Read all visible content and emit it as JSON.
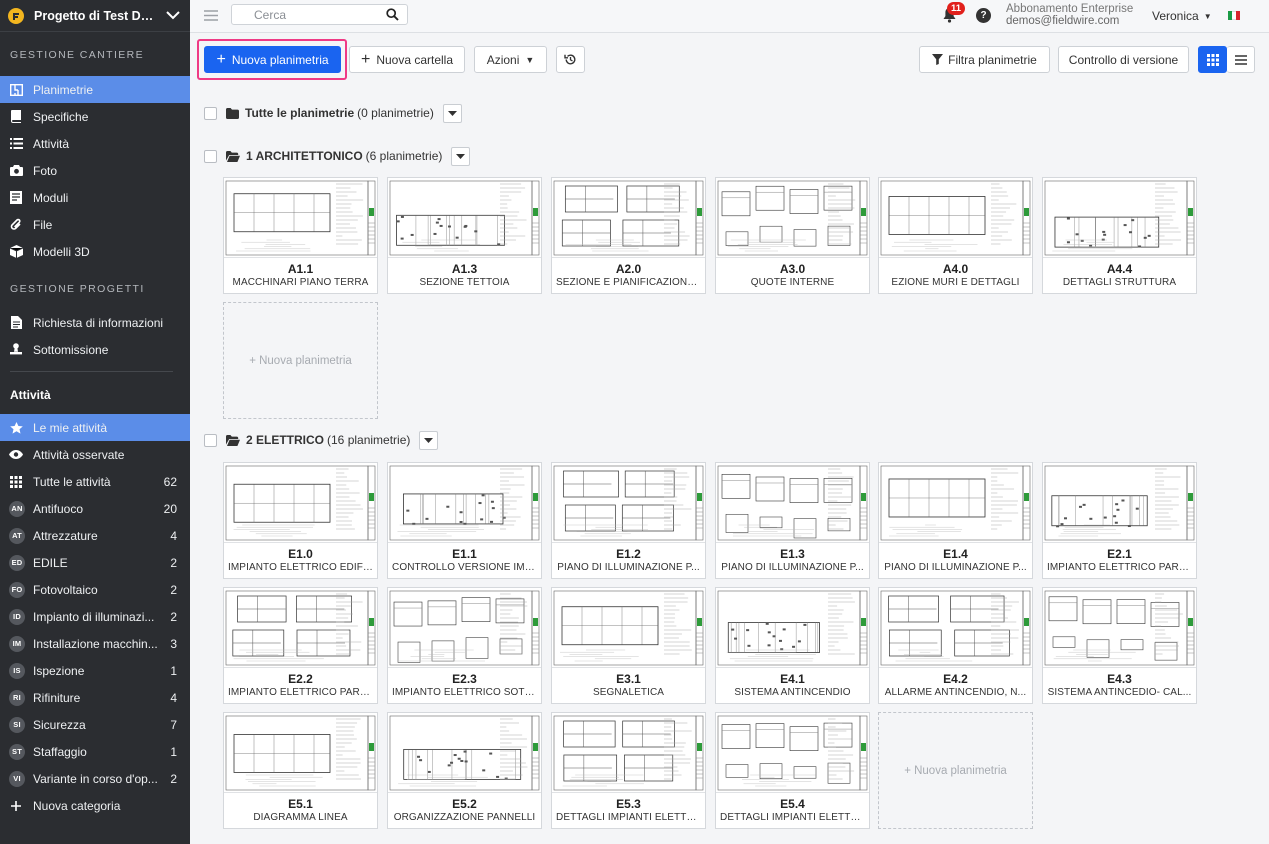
{
  "colors": {
    "accent": "#1a64f0",
    "sidebar": "#2b2d31",
    "active_item": "#5b8de8",
    "highlight": "#ef3a85",
    "notification": "#e1201c"
  },
  "sidebar": {
    "project_name": "Progetto di Test De...",
    "section_site": "GESTIONE CANTIERE",
    "site_items": [
      {
        "label": "Planimetrie",
        "icon": "floorplan-icon",
        "active": true
      },
      {
        "label": "Specifiche",
        "icon": "book-icon"
      },
      {
        "label": "Attività",
        "icon": "list-icon"
      },
      {
        "label": "Foto",
        "icon": "camera-icon"
      },
      {
        "label": "Moduli",
        "icon": "forms-icon"
      },
      {
        "label": "File",
        "icon": "paperclip-icon"
      },
      {
        "label": "Modelli 3D",
        "icon": "cube-icon"
      }
    ],
    "section_projects": "GESTIONE PROGETTI",
    "project_items": [
      {
        "label": "Richiesta di informazioni",
        "icon": "document-icon"
      },
      {
        "label": "Sottomissione",
        "icon": "stamp-icon"
      }
    ],
    "section_tasks": "Attività",
    "task_items": [
      {
        "label": "Le mie attività",
        "icon": "star-icon",
        "active": true
      },
      {
        "label": "Attività osservate",
        "icon": "eye-icon"
      },
      {
        "label": "Tutte le attività",
        "icon": "grid-dots-icon",
        "count": "62"
      }
    ],
    "categories": [
      {
        "abbr": "AN",
        "label": "Antifuoco",
        "count": "20"
      },
      {
        "abbr": "AT",
        "label": "Attrezzature",
        "count": "4"
      },
      {
        "abbr": "ED",
        "label": "EDILE",
        "count": "2"
      },
      {
        "abbr": "FO",
        "label": "Fotovoltaico",
        "count": "2"
      },
      {
        "abbr": "ID",
        "label": "Impianto di illuminazi...",
        "count": "2"
      },
      {
        "abbr": "IM",
        "label": "Installazione macchin...",
        "count": "3"
      },
      {
        "abbr": "IS",
        "label": "Ispezione",
        "count": "1"
      },
      {
        "abbr": "RI",
        "label": "Rifiniture",
        "count": "4"
      },
      {
        "abbr": "SI",
        "label": "Sicurezza",
        "count": "7"
      },
      {
        "abbr": "ST",
        "label": "Staffaggio",
        "count": "1"
      },
      {
        "abbr": "VI",
        "label": "Variante in corso d'op...",
        "count": "2"
      }
    ],
    "new_category": "Nuova categoria"
  },
  "header": {
    "search_placeholder": "Cerca",
    "notification_count": "11",
    "help": "?",
    "plan_name": "Abbonamento Enterprise",
    "email": "demos@fieldwire.com",
    "user": "Veronica"
  },
  "toolbar": {
    "new_sheet": "Nuova planimetria",
    "new_folder": "Nuova cartella",
    "actions": "Azioni",
    "filter": "Filtra planimetrie",
    "version_control": "Controllo di versione",
    "view_mode": "grid"
  },
  "folders": {
    "all": {
      "name": "Tutte le planimetrie",
      "count": "(0 planimetrie)"
    },
    "arch": {
      "name": "1 ARCHITETTONICO",
      "count": "(6 planimetrie)"
    },
    "elec": {
      "name": "2 ELETTRICO",
      "count": "(16 planimetrie)"
    }
  },
  "new_sheet_card": "+ Nuova planimetria",
  "sheets_arch": [
    {
      "code": "A1.1",
      "name": "MACCHINARI PIANO TERRA"
    },
    {
      "code": "A1.3",
      "name": "SEZIONE TETTOIA"
    },
    {
      "code": "A2.0",
      "name": "SEZIONE E PIANIFICAZIONE..."
    },
    {
      "code": "A3.0",
      "name": "QUOTE INTERNE"
    },
    {
      "code": "A4.0",
      "name": "EZIONE MURI E DETTAGLI"
    },
    {
      "code": "A4.4",
      "name": "DETTAGLI STRUTTURA"
    }
  ],
  "sheets_elec": [
    {
      "code": "E1.0",
      "name": "IMPIANTO ELETTRICO EDIFI..."
    },
    {
      "code": "E1.1",
      "name": "CONTROLLO VERSIONE IMP..."
    },
    {
      "code": "E1.2",
      "name": "PIANO DI ILLUMINAZIONE P..."
    },
    {
      "code": "E1.3",
      "name": "PIANO DI ILLUMINAZIONE P..."
    },
    {
      "code": "E1.4",
      "name": "PIANO DI ILLUMINAZIONE P..."
    },
    {
      "code": "E2.1",
      "name": "IMPIANTO ELETTRICO PARZ..."
    },
    {
      "code": "E2.2",
      "name": "IMPIANTO ELETTRICO PARZ..."
    },
    {
      "code": "E2.3",
      "name": "IMPIANTO ELETTRICO SOTT..."
    },
    {
      "code": "E3.1",
      "name": "SEGNALETICA"
    },
    {
      "code": "E4.1",
      "name": "SISTEMA ANTINCENDIO"
    },
    {
      "code": "E4.2",
      "name": "ALLARME ANTINCENDIO, N..."
    },
    {
      "code": "E4.3",
      "name": "SISTEMA ANTINCEDIO- CAL..."
    },
    {
      "code": "E5.1",
      "name": "DIAGRAMMA LINEA"
    },
    {
      "code": "E5.2",
      "name": "ORGANIZZAZIONE PANNELLI"
    },
    {
      "code": "E5.3",
      "name": "DETTAGLI IMPIANTI ELETTR..."
    },
    {
      "code": "E5.4",
      "name": "DETTAGLI IMPIANTI ELETTR..."
    }
  ]
}
